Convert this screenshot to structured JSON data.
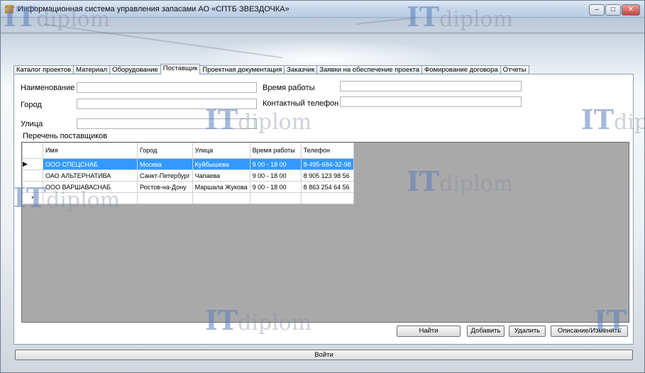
{
  "window": {
    "title": "Информационная система управления запасами АО «СПТБ ЗВЕЗДОЧКА»",
    "minimize": "‒",
    "maximize": "□",
    "close": "✕"
  },
  "tabs": [
    {
      "label": "Каталог проектов"
    },
    {
      "label": "Материал"
    },
    {
      "label": "Оборудование"
    },
    {
      "label": "Поставщик"
    },
    {
      "label": "Проектная документация"
    },
    {
      "label": "Заказчик"
    },
    {
      "label": "Заявки на обеспечение проекта"
    },
    {
      "label": "Фомирование договора"
    },
    {
      "label": "Отчеты"
    }
  ],
  "active_tab": "Поставщик",
  "form": {
    "name_label": "Наименование",
    "city_label": "Город",
    "street_label": "Улица",
    "hours_label": "Время работы",
    "phone_label": "Контактный телефон",
    "name_value": "",
    "city_value": "",
    "street_value": "",
    "hours_value": "",
    "phone_value": ""
  },
  "list_title": "Перечень поставщиков",
  "grid": {
    "headers": [
      "Имя",
      "Город",
      "Улица",
      "Время работы",
      "Телефон"
    ],
    "rows": [
      [
        "ООО СПЕЦСНАБ",
        "Москва",
        "Куйбышева",
        "9 00 - 18 00",
        "8-495-684-32-98"
      ],
      [
        "ОАО АЛЬТЕРНАТИВА",
        "Санкт-Петербург",
        "Чапаева",
        "9 00 - 18 00",
        "8 905 123 98 56"
      ],
      [
        "ООО ВАРШАВАСНАБ",
        "Ростов-на-Дону",
        "Маршала Жукова",
        "9 00 - 18 00",
        "8 863 254 64 56"
      ]
    ],
    "current_row_marker": "▶",
    "new_row_marker": "*"
  },
  "buttons": {
    "find": "Найти",
    "add": "Добавить",
    "delete": "Удалить",
    "describe": "Описание/Изменить",
    "login": "Войти"
  },
  "watermark": {
    "it": "IT",
    "diplom": "diplom"
  }
}
